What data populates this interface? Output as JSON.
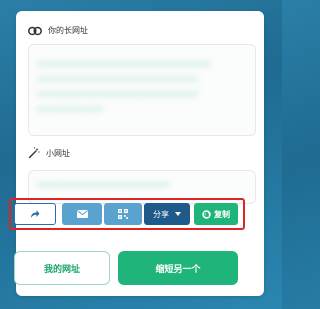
{
  "long_url": {
    "label": "你的长网址",
    "icon": "link-icon",
    "value": "xxxxxxxxxxxxxxxxxxxxxxxxxxxxxxxxxxxxxxxxxx\nxxxxxxxxxxxxxxxxxxxxxxxxxxxxxxxxxxxxxxx\nxxxxxxxxxxxxxxxxxxxxxxxxxxxxxxxxxxxxxxx\nxxxxxxxxxxxxxxxx"
  },
  "short_url": {
    "label": "小网址",
    "icon": "magic-wand-icon",
    "value": "xxxxxxxxxxxxxxxxxxxxxxxxxxxx"
  },
  "actions": {
    "forward_icon": "share-arrow-icon",
    "mail_icon": "envelope-icon",
    "qr_icon": "qr-code-icon",
    "share_label": "分享",
    "copy_label": "复制",
    "copy_icon": "copy-icon"
  },
  "footer": {
    "my_urls_label": "我的网址",
    "shorten_again_label": "缩短另一个"
  },
  "colors": {
    "accent_green": "#1fb57a",
    "share_dark_blue": "#1f5b8a",
    "light_blue": "#5ba3cf",
    "highlight_red": "#e02424"
  }
}
